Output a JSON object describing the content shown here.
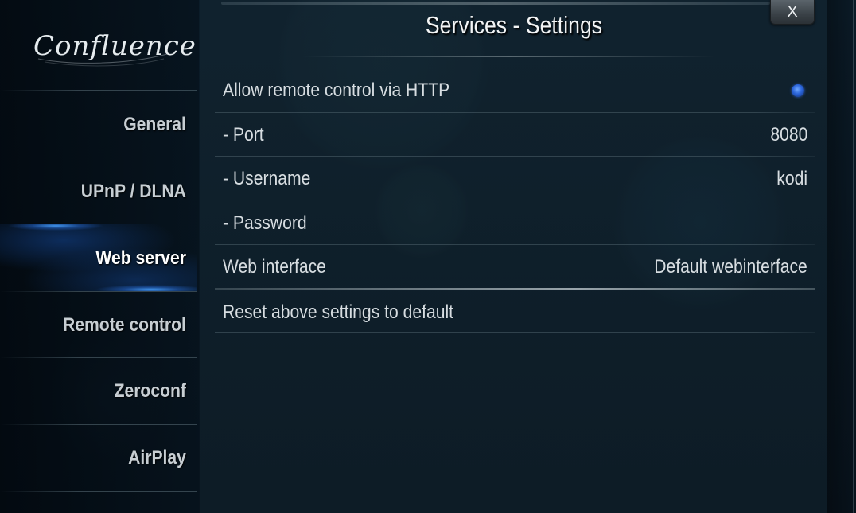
{
  "app": {
    "logo_text": "Confluence"
  },
  "header": {
    "title": "Services - Settings",
    "close_label": "X"
  },
  "sidebar": {
    "items": [
      {
        "label": "General"
      },
      {
        "label": "UPnP / DLNA"
      },
      {
        "label": "Web server",
        "active": true
      },
      {
        "label": "Remote control"
      },
      {
        "label": "Zeroconf"
      },
      {
        "label": "AirPlay"
      }
    ]
  },
  "settings": {
    "rows": [
      {
        "label": "Allow remote control via HTTP",
        "value": "",
        "control": "radio-on"
      },
      {
        "label": "- Port",
        "value": "8080"
      },
      {
        "label": "- Username",
        "value": "kodi"
      },
      {
        "label": "- Password",
        "value": ""
      },
      {
        "label": "Web interface",
        "value": "Default webinterface"
      },
      {
        "label": "Reset above settings to default",
        "value": ""
      }
    ]
  },
  "colors": {
    "accent": "#2a63d8",
    "text": "#d7dde1",
    "active_text": "#ffffff"
  }
}
